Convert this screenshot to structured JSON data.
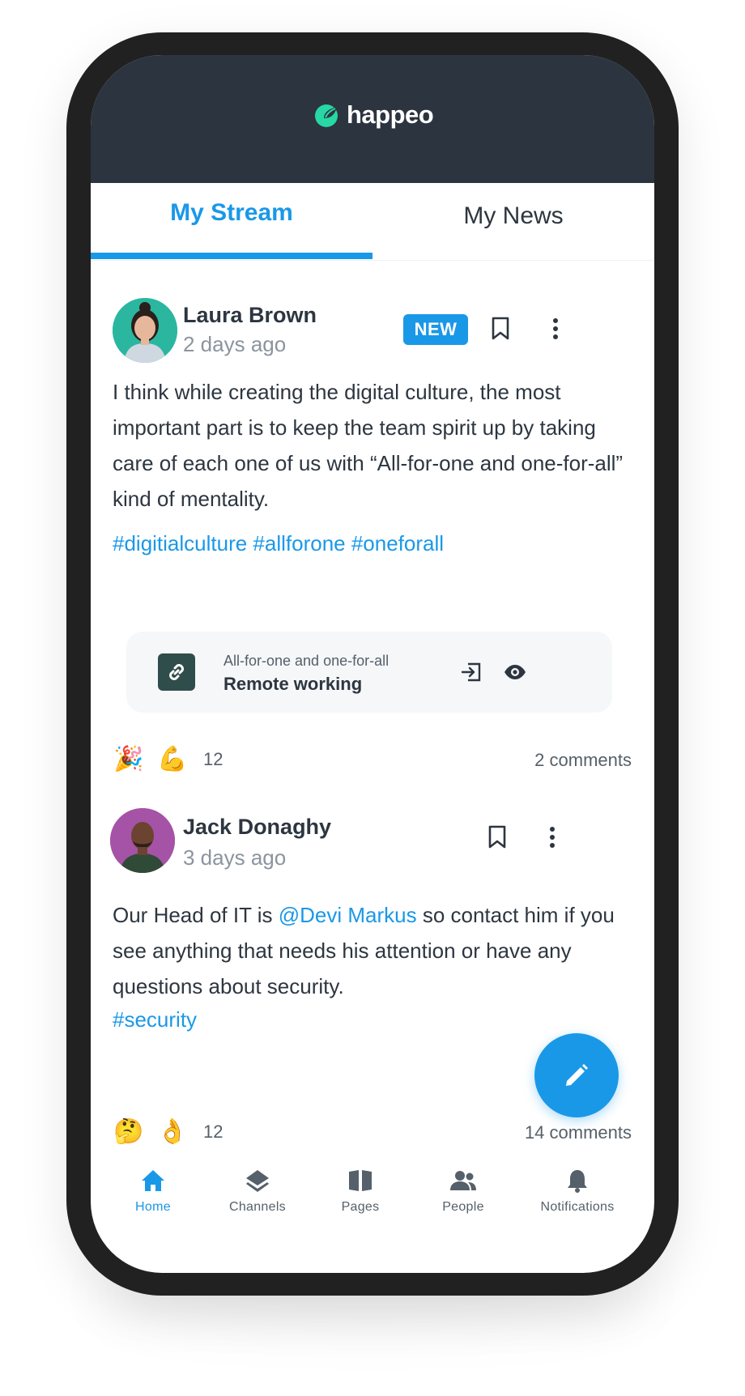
{
  "app": {
    "brand": "happeo"
  },
  "tabs": [
    {
      "label": "My Stream",
      "active": true
    },
    {
      "label": "My News",
      "active": false
    }
  ],
  "colors": {
    "accent": "#1a98e8",
    "header": "#2c3440",
    "brand_green": "#27d7a4"
  },
  "posts": [
    {
      "author": "Laura Brown",
      "time": "2 days ago",
      "badge": "NEW",
      "body": "I think while creating the digital culture, the most important part is to keep the team spirit up by taking care of each one of us with “All-for-one and one-for-all” kind of mentality.",
      "hashtags": "#digitialculture #allforone #oneforall",
      "link": {
        "subtitle": "All-for-one and one-for-all",
        "title": "Remote working"
      },
      "reactions": [
        "🎉",
        "💪"
      ],
      "reaction_count": "12",
      "comments": "2 comments"
    },
    {
      "author": "Jack Donaghy",
      "time": "3 days ago",
      "body_before": "Our Head of IT is ",
      "mention": "@Devi Markus",
      "body_after": " so contact him if you see anything that needs his attention or have any questions about security.",
      "hashtags": "#security",
      "reactions": [
        "🤔",
        "👌"
      ],
      "reaction_count": "12",
      "comments": "14 comments"
    }
  ],
  "nav": [
    {
      "label": "Home",
      "icon": "home-icon",
      "active": true
    },
    {
      "label": "Channels",
      "icon": "layers-icon"
    },
    {
      "label": "Pages",
      "icon": "book-icon"
    },
    {
      "label": "People",
      "icon": "people-icon"
    },
    {
      "label": "Notifications",
      "icon": "bell-icon"
    }
  ]
}
